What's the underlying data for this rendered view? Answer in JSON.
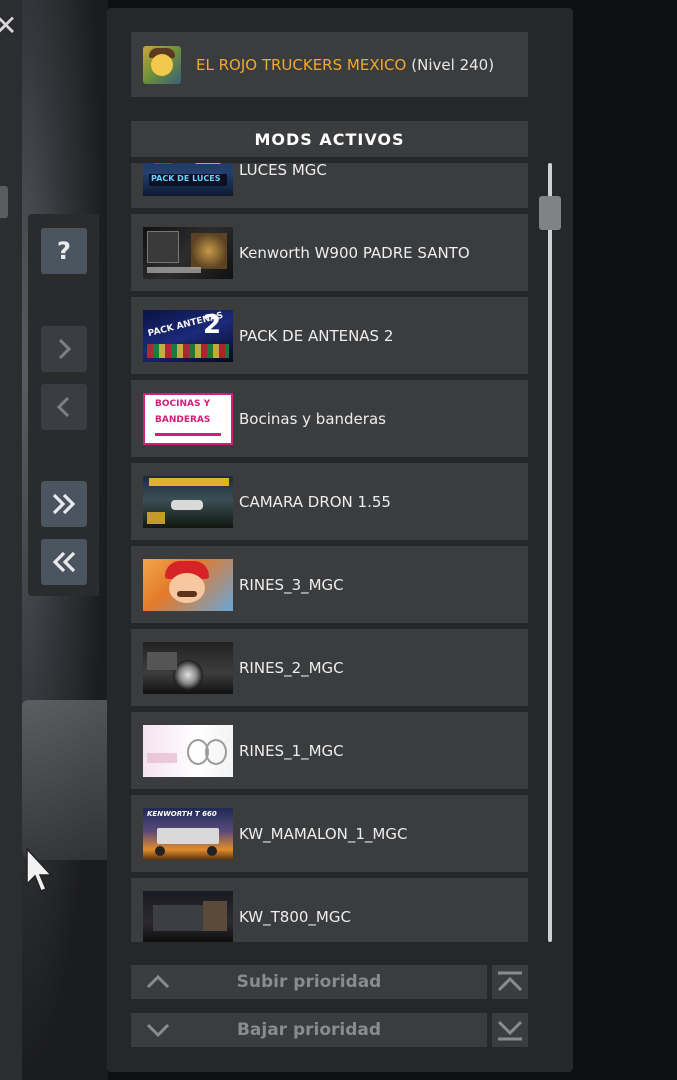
{
  "left_tools": {
    "help_label": "?",
    "icons": [
      "help-icon",
      "chevron-right-icon",
      "chevron-left-icon",
      "double-chevron-right-icon",
      "double-chevron-left-icon"
    ]
  },
  "profile": {
    "name": "EL ROJO TRUCKERS MEXICO",
    "level": "(Nivel 240)",
    "name_color": "#f0a92e"
  },
  "mods_header": "MODS ACTIVOS",
  "mods": [
    {
      "name": "LUCES MGC",
      "thumb": "pack-de-luces"
    },
    {
      "name": "Kenworth W900 PADRE SANTO",
      "thumb": "kenworth-w900"
    },
    {
      "name": "PACK DE ANTENAS 2",
      "thumb": "pack-antenas-2"
    },
    {
      "name": "Bocinas y banderas",
      "thumb": "bocinas-y-banderas"
    },
    {
      "name": "CAMARA DRON 1.55",
      "thumb": "camara-dron"
    },
    {
      "name": "RINES_3_MGC",
      "thumb": "mario"
    },
    {
      "name": "RINES_2_MGC",
      "thumb": "truck-wheels"
    },
    {
      "name": "RINES_1_MGC",
      "thumb": "rims-white"
    },
    {
      "name": "KW_MAMALON_1_MGC",
      "thumb": "kenworth-t660"
    },
    {
      "name": "KW_T800_MGC",
      "thumb": "kw-t800"
    }
  ],
  "thumb_texts": {
    "pack_de_luces": "PACK DE LUCES",
    "pack_antenas": "PACK ANTENAS",
    "pack_antenas_num": "2",
    "bocinas_line1": "BOCINAS Y",
    "bocinas_line2": "BANDERAS",
    "kenworth_t660": "KENWORTH T 660"
  },
  "buttons": {
    "raise_priority": "Subir prioridad",
    "lower_priority": "Bajar prioridad"
  }
}
